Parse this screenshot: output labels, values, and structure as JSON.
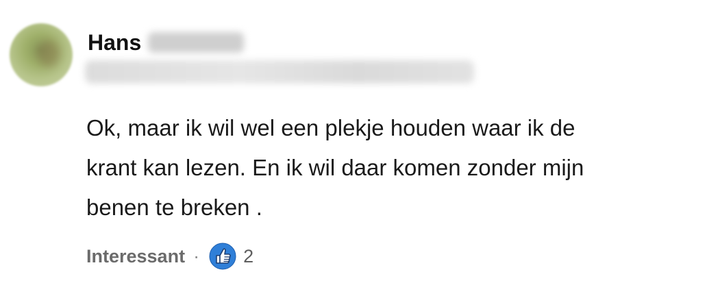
{
  "comment": {
    "author_first_name": "Hans",
    "body_lines": [
      "Ok, maar ik wil wel een plekje houden waar ik de",
      "krant kan lezen. En ik wil daar komen zonder mijn",
      "benen te breken ."
    ],
    "reaction_label": "Interessant",
    "separator": "·",
    "reaction_icon": "thumbs-up-icon",
    "reaction_count": "2",
    "accent_color": "#2f7fd8"
  }
}
